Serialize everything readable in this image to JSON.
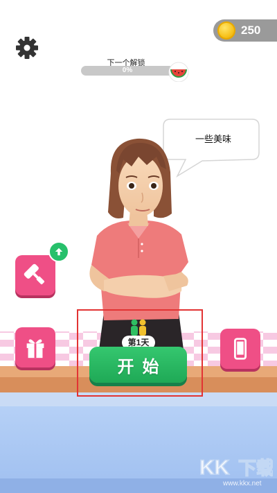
{
  "hud": {
    "coins": "250",
    "icons": [
      "gear-icon",
      "coin-icon"
    ]
  },
  "unlock": {
    "label": "下一个解锁",
    "percent_text": "0%",
    "progress": 0,
    "reward_icon": "watermelon-icon"
  },
  "speech": {
    "text": "一些美味"
  },
  "side_buttons": {
    "left_top_icon": "paint-roller-icon",
    "left_bottom_icon": "gift-icon",
    "right_icon": "phone-icon",
    "upgrade_icon": "arrow-up-icon"
  },
  "start": {
    "day_label": "第1天",
    "button_label": "开始",
    "players_icon": "two-players-icon"
  },
  "colors": {
    "pink_button": "#ef4f86",
    "green_button": "#27b565",
    "progress_track": "#c8c8c8",
    "coin_gold": "#f7c21c",
    "floor_blue": "#a9c8f3"
  }
}
